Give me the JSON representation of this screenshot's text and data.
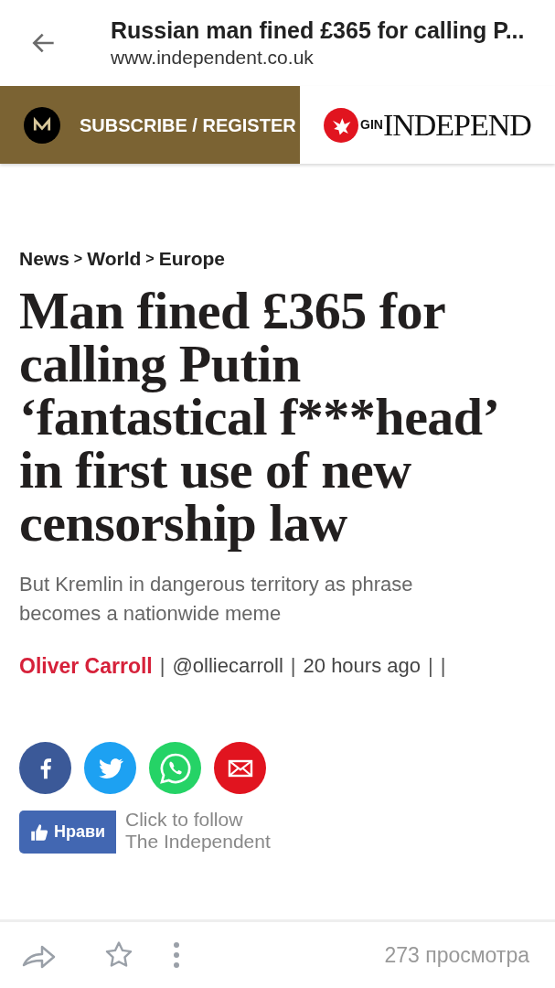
{
  "top_bar": {
    "title": "Russian man fined £365 for calling P...",
    "url": "www.independent.co.uk"
  },
  "site_header": {
    "subscribe": "SUBSCRIBE / REGISTER",
    "login_fragment": "GIN",
    "logo_text": "INDEPEND"
  },
  "breadcrumb": {
    "items": [
      "News",
      "World",
      "Europe"
    ],
    "separator": ">"
  },
  "headline": "Man fined £365 for calling Putin ‘fantastical f***head’ in first use of new censorship law",
  "standfirst": "But Kremlin in dangerous territory as phrase becomes a nationwide meme",
  "byline": [
    {
      "kind": "author",
      "text": "Oliver Carroll"
    },
    {
      "kind": "sep",
      "text": "|"
    },
    {
      "kind": "meta",
      "text": "@olliecarroll"
    },
    {
      "kind": "sep",
      "text": "|"
    },
    {
      "kind": "meta",
      "text": "20 hours ago"
    },
    {
      "kind": "sep",
      "text": "|"
    },
    {
      "kind": "sep",
      "text": "|"
    }
  ],
  "share_buttons": [
    {
      "kind": "facebook"
    },
    {
      "kind": "twitter"
    },
    {
      "kind": "whatsapp"
    },
    {
      "kind": "email"
    }
  ],
  "like_button": {
    "label": "Нрави"
  },
  "follow_text": [
    "Click to follow",
    "The Independent"
  ],
  "bottom_bar": {
    "views": "273 просмотра"
  }
}
